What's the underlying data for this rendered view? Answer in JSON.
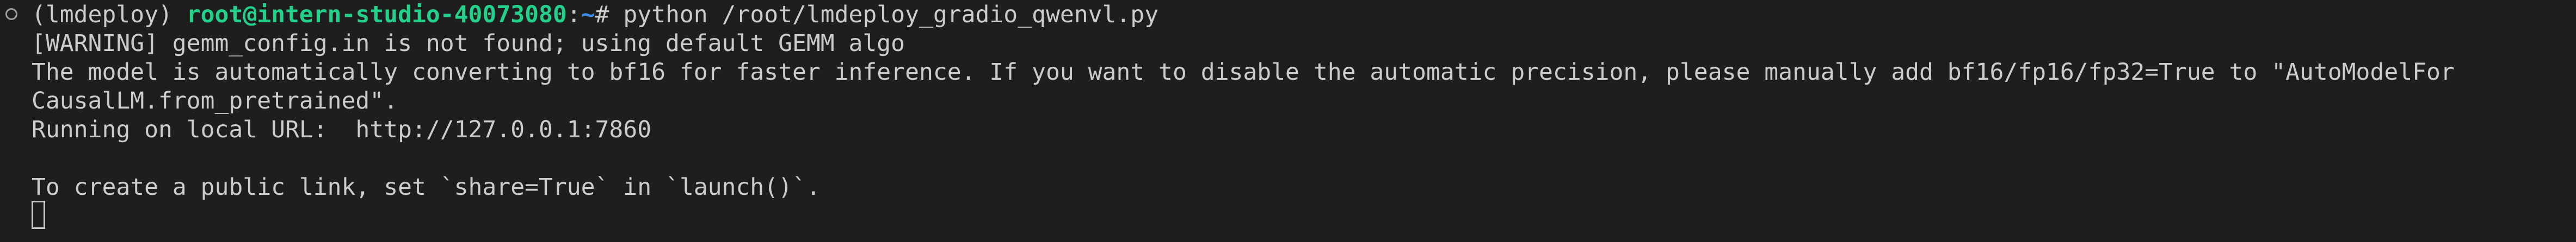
{
  "terminal": {
    "prompt": {
      "env": "(lmdeploy) ",
      "user_host": "root@intern-studio-40073080",
      "separator": ":",
      "cwd": "~",
      "symbol": "# ",
      "command": "python /root/lmdeploy_gradio_qwenvl.py"
    },
    "output_lines": [
      "[WARNING] gemm_config.in is not found; using default GEMM algo",
      "The model is automatically converting to bf16 for faster inference. If you want to disable the automatic precision, please manually add bf16/fp16/fp32=True to \"AutoModelFor",
      "CausalLM.from_pretrained\".",
      "Running on local URL:  http://127.0.0.1:7860",
      "",
      "To create a public link, set `share=True` in `launch()`."
    ]
  },
  "colors": {
    "background": "#1e1e1e",
    "text": "#cccccc",
    "user_host": "#23d18b",
    "cwd": "#3b8eea"
  },
  "icons": {
    "prompt_marker": "circle-icon",
    "cursor": "block-cursor-icon"
  }
}
